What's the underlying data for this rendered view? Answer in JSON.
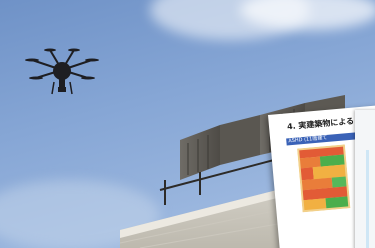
{
  "photo": {
    "subject": "drone-over-building",
    "document": {
      "heading": "4. 実建築物による",
      "subheading": "ASHD (11階建て"
    },
    "colors": {
      "sky": "#86a6d5",
      "building": "#e4e1d8",
      "drone": "#1e1e22",
      "doc_bar": "#3a62b7"
    }
  }
}
